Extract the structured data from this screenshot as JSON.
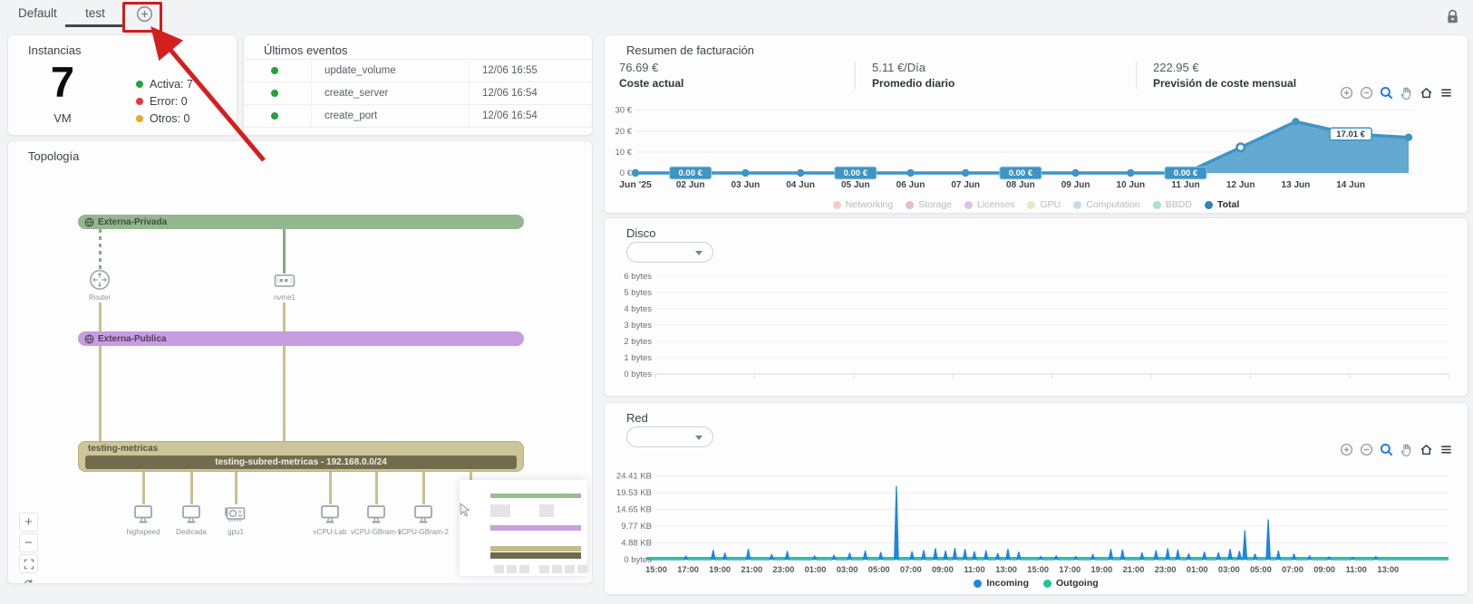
{
  "topbar": {
    "tabs": [
      {
        "label": "Default",
        "active": false
      },
      {
        "label": "test",
        "active": true
      }
    ]
  },
  "annotation": {
    "highlight_color": "#cf1d1d"
  },
  "instancias": {
    "title": "Instancias",
    "count": "7",
    "unit": "VM",
    "legend": [
      {
        "label": "Activa: 7",
        "color": "#23a33b"
      },
      {
        "label": "Error: 0",
        "color": "#e4393c"
      },
      {
        "label": "Otros: 0",
        "color": "#f2a51f"
      }
    ]
  },
  "eventos": {
    "title": "Últimos eventos",
    "rows": [
      {
        "status_color": "#23a33b",
        "name": "update_volume",
        "time": "12/06 16:55"
      },
      {
        "status_color": "#23a33b",
        "name": "create_server",
        "time": "12/06 16:54"
      },
      {
        "status_color": "#23a33b",
        "name": "create_port",
        "time": "12/06 16:54"
      }
    ]
  },
  "topologia": {
    "title": "Topología",
    "networks": [
      {
        "name": "Externa-Privada",
        "color": "#93b78e"
      },
      {
        "name": "Externa-Publica",
        "color": "#c79ce0"
      },
      {
        "name": "testing-metricas",
        "color": "#cdc497",
        "subnet": "testing-subred-metricas - 192.168.0.0/24"
      }
    ],
    "router_label": "Router",
    "port_label": "nvme1",
    "vms": [
      "highspeed",
      "Dedicada",
      "gpu1",
      "vCPU-Lab",
      "vCPU-GBram-1",
      "vCPU-GBram-2",
      ""
    ]
  },
  "facturacion": {
    "title": "Resumen de facturación",
    "stats": [
      {
        "value": "76.69 €",
        "label": "Coste actual"
      },
      {
        "value": "5.11 €/Día",
        "label": "Promedio diario"
      },
      {
        "value": "222.95 €",
        "label": "Previsión de coste mensual"
      }
    ],
    "toolbar": [
      "zoom-in",
      "zoom-out",
      "zoom-select",
      "pan",
      "home",
      "menu"
    ]
  },
  "disco": {
    "title": "Disco",
    "filter_value": ""
  },
  "red": {
    "title": "Red",
    "filter_value": "",
    "toolbar": [
      "zoom-in",
      "zoom-out",
      "zoom-select",
      "pan",
      "home",
      "menu"
    ]
  },
  "chart_data": [
    {
      "id": "billing",
      "type": "area",
      "title": "Resumen de facturación",
      "x_labels": [
        "Jun '25",
        "02 Jun",
        "03 Jun",
        "04 Jun",
        "05 Jun",
        "06 Jun",
        "07 Jun",
        "08 Jun",
        "09 Jun",
        "10 Jun",
        "11 Jun",
        "12 Jun",
        "13 Jun",
        "14 Jun"
      ],
      "y_ticks": [
        "0 €",
        "10 €",
        "20 €",
        "30 €"
      ],
      "ymax": 32,
      "series": [
        {
          "name": "Total",
          "color": "#3e94c5",
          "values": [
            0,
            0,
            0,
            0,
            0,
            0,
            0,
            0,
            0,
            0,
            0,
            12.2,
            24.5,
            18.6,
            17.01
          ]
        }
      ],
      "point_labels": [
        {
          "at": 1,
          "text": "0.00 €",
          "style": "solid"
        },
        {
          "at": 4,
          "text": "0.00 €",
          "style": "solid"
        },
        {
          "at": 7,
          "text": "0.00 €",
          "style": "solid"
        },
        {
          "at": 10,
          "text": "0.00 €",
          "style": "solid"
        },
        {
          "at": 13,
          "text": "17.01 €",
          "style": "outline"
        }
      ],
      "legend": [
        {
          "label": "Networking",
          "color": "#f3cbc7",
          "muted": true
        },
        {
          "label": "Storage",
          "color": "#f2b6c5",
          "muted": true
        },
        {
          "label": "Licenses",
          "color": "#d8c2ea",
          "muted": true
        },
        {
          "label": "GPU",
          "color": "#e3ebc6",
          "muted": true
        },
        {
          "label": "Computation",
          "color": "#c2dcf0",
          "muted": true
        },
        {
          "label": "BBDD",
          "color": "#b3dcd4",
          "muted": true
        },
        {
          "label": "Total",
          "color": "#2b84bd",
          "muted": false
        }
      ],
      "legend_position": "bottom"
    },
    {
      "id": "disco",
      "type": "line",
      "title": "Disco",
      "x_labels": [],
      "y_ticks": [
        "0 bytes",
        "1 bytes",
        "2 bytes",
        "3 bytes",
        "4 bytes",
        "5 bytes",
        "6 bytes"
      ],
      "series": [],
      "grid": true
    },
    {
      "id": "red",
      "type": "area",
      "title": "Red",
      "x_labels": [
        "15:00",
        "17:00",
        "19:00",
        "21:00",
        "23:00",
        "01:00",
        "03:00",
        "05:00",
        "07:00",
        "09:00",
        "11:00",
        "13:00",
        "15:00",
        "17:00",
        "19:00",
        "21:00",
        "23:00",
        "01:00",
        "03:00",
        "05:00",
        "07:00",
        "09:00",
        "11:00",
        "13:00"
      ],
      "y_ticks": [
        "0 bytes",
        "4.88 KB",
        "9.77 KB",
        "14.65 KB",
        "19.53 KB",
        "24.41 KB"
      ],
      "ymax_kb": 25.6,
      "series": [
        {
          "name": "Incoming",
          "color": "#1c87e0",
          "spikes": [
            [
              0.045,
              1.0
            ],
            [
              0.08,
              2.7
            ],
            [
              0.095,
              1.9
            ],
            [
              0.125,
              3.0
            ],
            [
              0.155,
              1.5
            ],
            [
              0.175,
              2.4
            ],
            [
              0.21,
              1.1
            ],
            [
              0.235,
              1.3
            ],
            [
              0.255,
              1.9
            ],
            [
              0.275,
              2.5
            ],
            [
              0.295,
              2.1
            ],
            [
              0.315,
              21.3
            ],
            [
              0.335,
              2.3
            ],
            [
              0.35,
              2.7
            ],
            [
              0.365,
              3.2
            ],
            [
              0.378,
              2.5
            ],
            [
              0.39,
              3.3
            ],
            [
              0.403,
              3.0
            ],
            [
              0.415,
              2.3
            ],
            [
              0.43,
              2.6
            ],
            [
              0.445,
              1.8
            ],
            [
              0.458,
              3.0
            ],
            [
              0.472,
              2.2
            ],
            [
              0.5,
              0.9
            ],
            [
              0.52,
              1.1
            ],
            [
              0.545,
              0.9
            ],
            [
              0.567,
              1.5
            ],
            [
              0.59,
              3.0
            ],
            [
              0.605,
              2.8
            ],
            [
              0.63,
              2.0
            ],
            [
              0.648,
              2.6
            ],
            [
              0.663,
              3.2
            ],
            [
              0.676,
              2.8
            ],
            [
              0.69,
              1.7
            ],
            [
              0.71,
              2.2
            ],
            [
              0.728,
              2.0
            ],
            [
              0.743,
              3.0
            ],
            [
              0.755,
              2.4
            ],
            [
              0.762,
              8.4
            ],
            [
              0.775,
              1.6
            ],
            [
              0.792,
              11.6
            ],
            [
              0.805,
              2.5
            ],
            [
              0.825,
              1.6
            ],
            [
              0.845,
              1.1
            ],
            [
              0.87,
              0.8
            ],
            [
              0.9,
              0.7
            ],
            [
              0.93,
              0.9
            ]
          ]
        },
        {
          "name": "Outgoing",
          "color": "#25c296",
          "baseline_kb": 0.3
        }
      ],
      "legend": [
        {
          "label": "Incoming",
          "color": "#1c87e0"
        },
        {
          "label": "Outgoing",
          "color": "#25c296"
        }
      ],
      "legend_position": "bottom"
    }
  ]
}
